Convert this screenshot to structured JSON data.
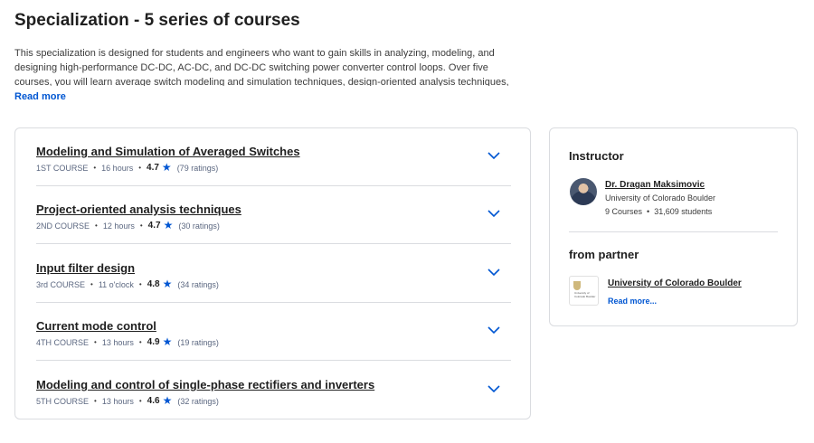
{
  "heading": "Specialization - 5 series of courses",
  "description": "This specialization is designed for students and engineers who want to gain skills in analyzing, modeling, and designing high-performance DC-DC, AC-DC, and DC-DC switching power converter control loops. Over five courses, you will learn average switch modeling and simulation techniques, design-oriented analysis techniques, input filter design, peak- and average-current control",
  "read_more_label": "Read more",
  "courses": [
    {
      "title": "Modeling and Simulation of Averaged Switches",
      "order": "1ST COURSE",
      "duration": "16 hours",
      "rating": "4.7",
      "ratings_count": "(79 ratings)"
    },
    {
      "title": "Project-oriented analysis techniques",
      "order": "2ND COURSE",
      "duration": "12 hours",
      "rating": "4.7",
      "ratings_count": "(30 ratings)"
    },
    {
      "title": "Input filter design",
      "order": "3rd COURSE",
      "duration": "11 o'clock",
      "rating": "4.8",
      "ratings_count": "(34 ratings)"
    },
    {
      "title": "Current mode control",
      "order": "4TH COURSE",
      "duration": "13 hours",
      "rating": "4.9",
      "ratings_count": "(19 ratings)"
    },
    {
      "title": "Modeling and control of single-phase rectifiers and inverters",
      "order": "5TH COURSE",
      "duration": "13 hours",
      "rating": "4.6",
      "ratings_count": "(32 ratings)"
    }
  ],
  "instructor": {
    "heading": "Instructor",
    "name": "Dr. Dragan Maksimovic",
    "org": "University of Colorado Boulder",
    "courses": "9 Courses",
    "students": "31,609 students"
  },
  "partner": {
    "heading": "from partner",
    "name": "University of Colorado Boulder",
    "logo_text": "University of Colorado Boulder",
    "read_more": "Read more..."
  },
  "colors": {
    "accent": "#0056d2",
    "border": "#dadce0",
    "star": "#0056d2"
  },
  "icons": {
    "expand": "chevron-down-icon",
    "rating": "star-icon"
  }
}
